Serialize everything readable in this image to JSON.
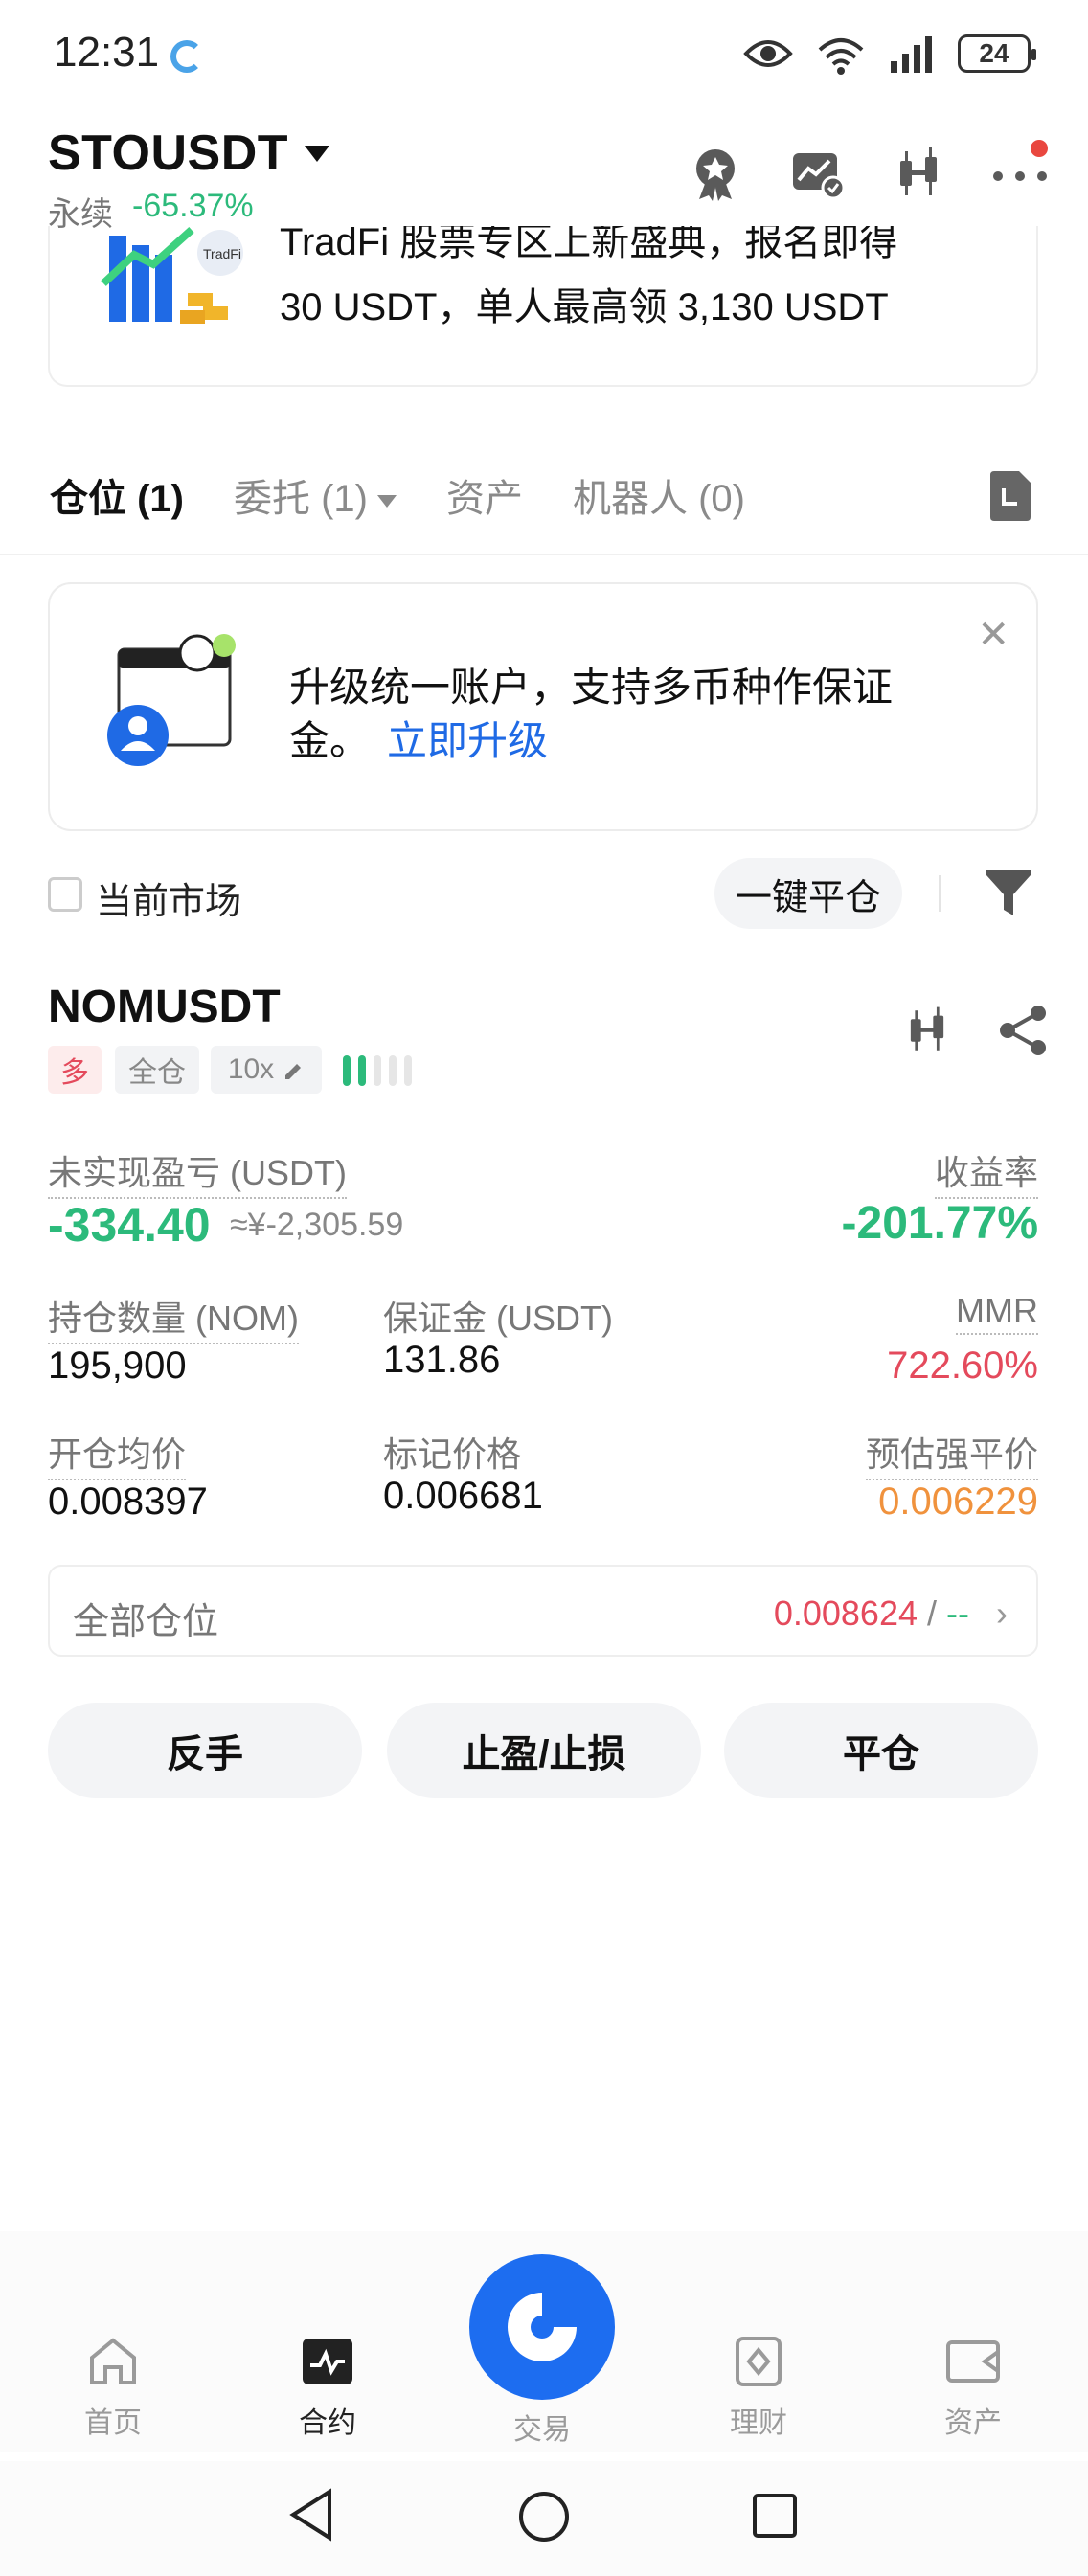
{
  "status_bar": {
    "time": "12:31",
    "battery": "24"
  },
  "header": {
    "symbol": "STOUSDT",
    "sub_label": "永续",
    "change": "-65.37%"
  },
  "banner": {
    "line1": "TradFi 股票专区上新盛典，报名即得",
    "line2": "30 USDT，单人最高领 3,130 USDT"
  },
  "tabs": [
    {
      "label": "仓位 (1)"
    },
    {
      "label": "委托 (1)"
    },
    {
      "label": "资产"
    },
    {
      "label": "机器人 (0)"
    }
  ],
  "upgrade": {
    "text": "升级统一账户，支持多币种作保证金。",
    "link": "立即升级"
  },
  "filter": {
    "current_market": "当前市场",
    "close_all": "一键平仓"
  },
  "position": {
    "symbol": "NOMUSDT",
    "side": "多",
    "margin_mode": "全仓",
    "leverage": "10x",
    "unrealized_pnl_label": "未实现盈亏 (USDT)",
    "unrealized_pnl": "-334.40",
    "unrealized_pnl_cny": "≈¥-2,305.59",
    "roe_label": "收益率",
    "roe": "-201.77%",
    "size_label": "持仓数量 (NOM)",
    "size": "195,900",
    "margin_label": "保证金 (USDT)",
    "margin": "131.86",
    "mmr_label": "MMR",
    "mmr": "722.60%",
    "entry_label": "开仓均价",
    "entry": "0.008397",
    "mark_label": "标记价格",
    "mark": "0.006681",
    "liq_label": "预估强平价",
    "liq": "0.006229",
    "all_positions_label": "全部仓位",
    "all_positions_value": "0.008624",
    "all_positions_sep": " / ",
    "all_positions_dash": "--",
    "actions": {
      "reverse": "反手",
      "tpsl": "止盈/止损",
      "close": "平仓"
    }
  },
  "bottom_nav": [
    {
      "label": "首页"
    },
    {
      "label": "合约"
    },
    {
      "label": "交易"
    },
    {
      "label": "理财"
    },
    {
      "label": "资产"
    }
  ],
  "colors": {
    "green": "#2cba7b",
    "red": "#e44a5c",
    "orange": "#f0923d",
    "blue": "#1d6df0"
  }
}
